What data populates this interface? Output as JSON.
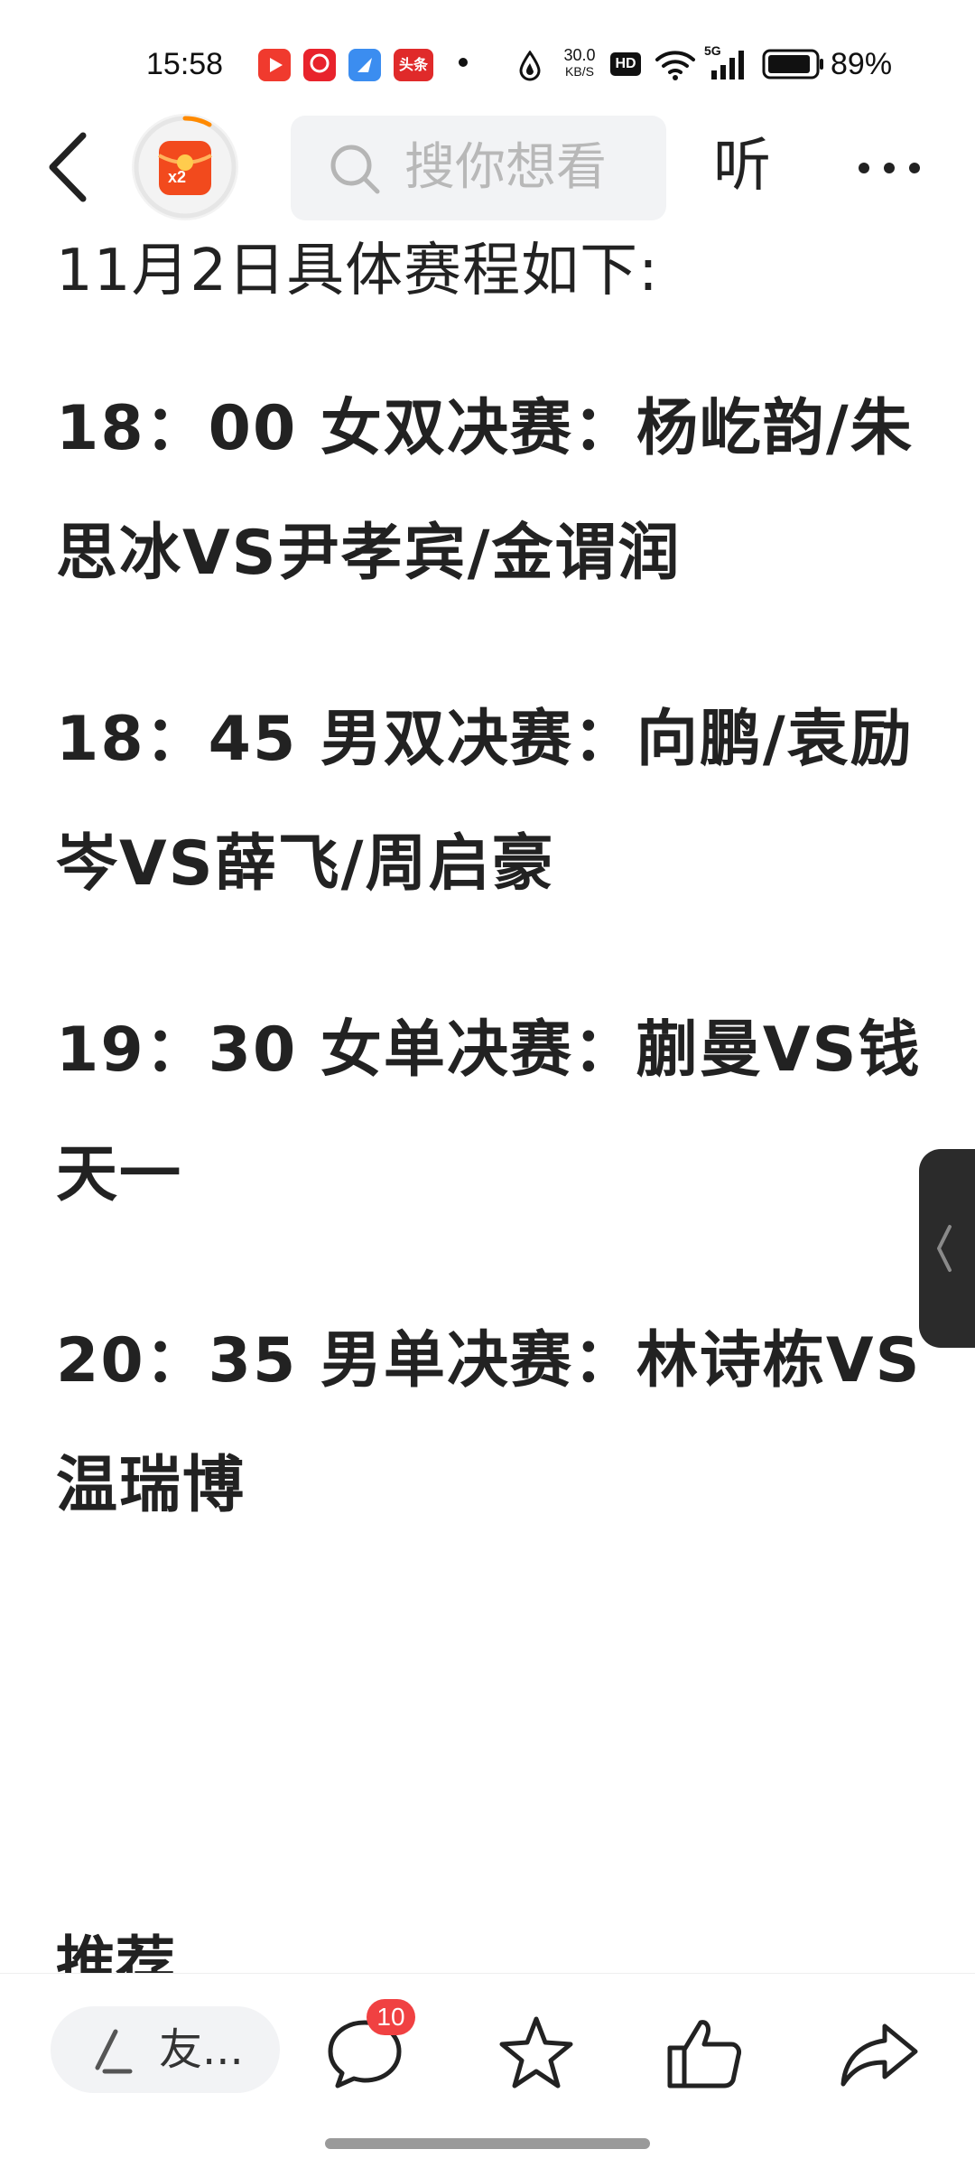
{
  "status_bar": {
    "time": "15:58",
    "net_speed_value": "30.0",
    "net_speed_unit": "KB/S",
    "hd_label": "HD",
    "signal_label": "5G",
    "battery_percent": "89%",
    "apps": [
      {
        "name": "video-app-icon",
        "color": "#f03a2e"
      },
      {
        "name": "shopping-app-icon",
        "color": "#e8232c"
      },
      {
        "name": "browser-app-icon",
        "color": "#3b8df0"
      },
      {
        "name": "toutiao-app-icon",
        "color": "#e02a2a",
        "label": "头条"
      }
    ]
  },
  "header": {
    "redpacket_badge": "x2",
    "search_placeholder": "搜你想看",
    "listen_label": "听"
  },
  "article": {
    "heading": "11月2日具体赛程如下:",
    "schedule": [
      "18：00 女双决赛：杨屹韵/朱思冰VS尹孝宾/金谓润",
      "18：45 男双决赛：向鹏/袁励岑VS薛飞/周启豪",
      "19：30 女单决赛：蒯曼VS钱天一",
      "20：35 男单决赛：林诗栋VS温瑞博"
    ],
    "next_section_heading": "推荐"
  },
  "bottom_bar": {
    "comment_placeholder": "友...",
    "comment_count": "10"
  },
  "colors": {
    "accent_red": "#f04142",
    "text": "#222222",
    "search_bg": "#f2f3f5"
  }
}
